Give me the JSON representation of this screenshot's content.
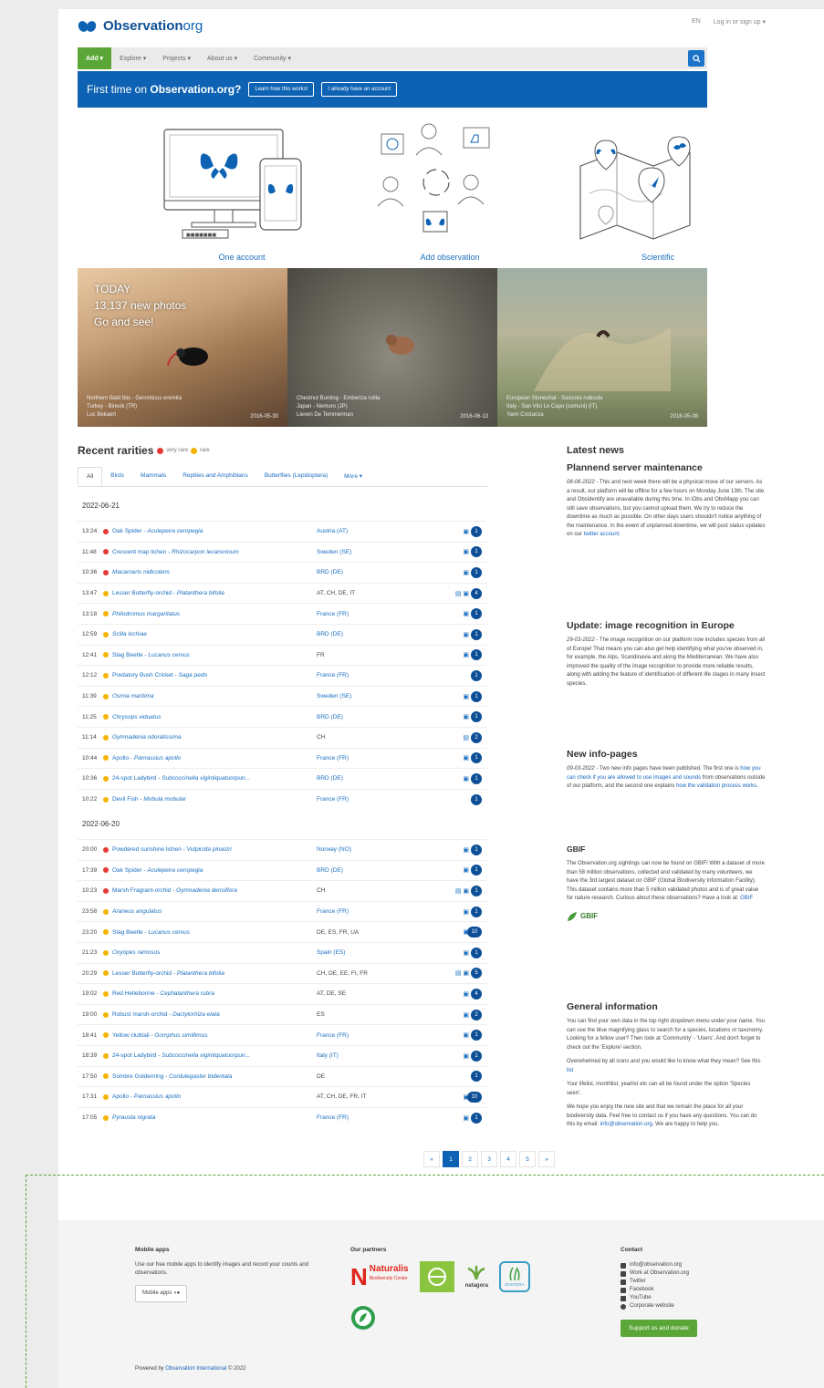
{
  "header": {
    "logo_main": "Observation",
    "logo_suffix": "org",
    "lang": "EN",
    "login": "Log in or sign up ▾"
  },
  "nav": {
    "add": "Add ▾",
    "items": [
      "Explore ▾",
      "Projects ▾",
      "About us ▾",
      "Community ▾"
    ]
  },
  "banner": {
    "text_prefix": "First time on ",
    "text_bold": "Observation.org?",
    "btn_learn": "Learn how this works!",
    "btn_account": "I already have an account"
  },
  "features": [
    "One account",
    "Add observation",
    "Scientific"
  ],
  "photos": {
    "today_line1": "TODAY",
    "today_line2": "13,137 new photos",
    "today_line3": "Go and see!",
    "items": [
      {
        "species": "Northern Bald Ibis - Geronticus eremita",
        "place": "Turkey - Birecik (TR)",
        "user": "Luc Bekaert",
        "date": "2016-05-30"
      },
      {
        "species": "Chestnut Bunting - Emberiza rutila",
        "place": "Japan - Nemuro (JP)",
        "user": "Lieven De Temmerman",
        "date": "2016-06-13"
      },
      {
        "species": "European Stonechat - Saxicola rubicola",
        "place": "Italy - San Vito Lo Capo (comuni) (IT)",
        "user": "Yann Costanza",
        "date": "2016-05-08"
      }
    ]
  },
  "rarities": {
    "title": "Recent rarities",
    "legend_very_rare": "very rare",
    "legend_rare": "rare",
    "tabs": [
      "All",
      "Birds",
      "Mammals",
      "Reptiles and Amphibians",
      "Butterflies (Lepidoptera)",
      "More ▾"
    ],
    "day1": "2022-06-21",
    "day2": "2022-06-20",
    "rows1": [
      {
        "time": "13:24",
        "rarity": "very-rare",
        "common": "Oak Spider - ",
        "sci": "Aculepeira ceropegia",
        "loc": "Austria (AT)",
        "link": true,
        "icons": "▣",
        "count": "1"
      },
      {
        "time": "11:48",
        "rarity": "very-rare",
        "common": "Crescent map lichen - ",
        "sci": "Rhizocarpon lecanorinum",
        "loc": "Sweden (SE)",
        "link": true,
        "icons": "▣",
        "count": "1"
      },
      {
        "time": "10:36",
        "rarity": "very-rare",
        "common": "",
        "sci": "Macaroeris nidicolens",
        "loc": "BRD (DE)",
        "link": true,
        "icons": "▣",
        "count": "1"
      },
      {
        "time": "13:47",
        "rarity": "rare",
        "common": "Lesser Butterfly-orchid - ",
        "sci": "Platanthera bifolia",
        "loc": "AT, CH, DE, IT",
        "link": false,
        "icons": "▤ ▣",
        "count": "4"
      },
      {
        "time": "13:18",
        "rarity": "rare",
        "common": "",
        "sci": "Philodromus margaritatus",
        "loc": "France (FR)",
        "link": true,
        "icons": "▣",
        "count": "1"
      },
      {
        "time": "12:59",
        "rarity": "rare",
        "common": "",
        "sci": "Scilla lochiae",
        "loc": "BRD (DE)",
        "link": true,
        "icons": "▣",
        "count": "1"
      },
      {
        "time": "12:41",
        "rarity": "rare",
        "common": "Stag Beetle - ",
        "sci": "Lucanus cervus",
        "loc": "FR",
        "link": false,
        "icons": "▣",
        "count": "1"
      },
      {
        "time": "12:12",
        "rarity": "rare",
        "common": "Predatory Bush Cricket - ",
        "sci": "Saga pedo",
        "loc": "France (FR)",
        "link": true,
        "icons": "",
        "count": "1"
      },
      {
        "time": "11:39",
        "rarity": "rare",
        "common": "",
        "sci": "Osmia maritima",
        "loc": "Sweden (SE)",
        "link": true,
        "icons": "▣",
        "count": "1"
      },
      {
        "time": "11:25",
        "rarity": "rare",
        "common": "",
        "sci": "Chrysops viduatus",
        "loc": "BRD (DE)",
        "link": true,
        "icons": "▣",
        "count": "1"
      },
      {
        "time": "11:14",
        "rarity": "rare",
        "common": "",
        "sci": "Gymnadenia odoratissima",
        "loc": "CH",
        "link": false,
        "icons": "▤",
        "count": "2"
      },
      {
        "time": "10:44",
        "rarity": "rare",
        "common": "Apollo - ",
        "sci": "Parnassius apollo",
        "loc": "France (FR)",
        "link": true,
        "icons": "▣",
        "count": "1"
      },
      {
        "time": "10:36",
        "rarity": "rare",
        "common": "24-spot Ladybird - ",
        "sci": "Subcoccinella vigintiquatuorpun...",
        "loc": "BRD (DE)",
        "link": true,
        "icons": "▣",
        "count": "1"
      },
      {
        "time": "10:22",
        "rarity": "rare",
        "common": "Devil Fish - ",
        "sci": "Mobula mobular",
        "loc": "France (FR)",
        "link": true,
        "icons": "",
        "count": "1"
      }
    ],
    "rows2": [
      {
        "time": "20:00",
        "rarity": "very-rare",
        "common": "Powdered sunshine lichen - ",
        "sci": "Vulpicida pinastri",
        "loc": "Norway (NO)",
        "link": true,
        "icons": "▣",
        "count": "1"
      },
      {
        "time": "17:39",
        "rarity": "very-rare",
        "common": "Oak Spider - ",
        "sci": "Aculepeira ceropegia",
        "loc": "BRD (DE)",
        "link": true,
        "icons": "▣",
        "count": "1"
      },
      {
        "time": "10:23",
        "rarity": "very-rare",
        "common": "Marsh Fragrant-orchid - ",
        "sci": "Gymnadenia densiflora",
        "loc": "CH",
        "link": false,
        "icons": "▤ ▣",
        "count": "1"
      },
      {
        "time": "23:58",
        "rarity": "rare",
        "common": "",
        "sci": "Araneus angulatus",
        "loc": "France (FR)",
        "link": true,
        "icons": "▣",
        "count": "1"
      },
      {
        "time": "23:20",
        "rarity": "rare",
        "common": "Stag Beetle - ",
        "sci": "Lucanus cervus",
        "loc": "DE, ES, FR, UA",
        "link": false,
        "icons": "▣",
        "count": "10"
      },
      {
        "time": "21:23",
        "rarity": "rare",
        "common": "",
        "sci": "Oxyopes ramosus",
        "loc": "Spain (ES)",
        "link": true,
        "icons": "▣",
        "count": "1"
      },
      {
        "time": "20:29",
        "rarity": "rare",
        "common": "Lesser Butterfly-orchid - ",
        "sci": "Platanthera bifolia",
        "loc": "CH, DE, EE, FI, FR",
        "link": false,
        "icons": "▤ ▣",
        "count": "5"
      },
      {
        "time": "19:02",
        "rarity": "rare",
        "common": "Red Helleborine - ",
        "sci": "Cephalanthera rubra",
        "loc": "AT, DE, SE",
        "link": false,
        "icons": "▣",
        "count": "4"
      },
      {
        "time": "19:00",
        "rarity": "rare",
        "common": "Robust marsh-orchid - ",
        "sci": "Dactylorhiza elata",
        "loc": "ES",
        "link": false,
        "icons": "▣",
        "count": "2"
      },
      {
        "time": "18:41",
        "rarity": "rare",
        "common": "Yellow clubtail - ",
        "sci": "Gomphus simillimus",
        "loc": "France (FR)",
        "link": true,
        "icons": "▣",
        "count": "1"
      },
      {
        "time": "18:39",
        "rarity": "rare",
        "common": "24-spot Ladybird - ",
        "sci": "Subcoccinella vigintiquatuorpun...",
        "loc": "Italy (IT)",
        "link": true,
        "icons": "▣",
        "count": "1"
      },
      {
        "time": "17:50",
        "rarity": "rare",
        "common": "Sombre Goldenring - ",
        "sci": "Cordulegaster bidentata",
        "loc": "DE",
        "link": false,
        "icons": "",
        "count": "1"
      },
      {
        "time": "17:31",
        "rarity": "rare",
        "common": "Apollo - ",
        "sci": "Parnassius apollo",
        "loc": "AT, CH, DE, FR, IT",
        "link": false,
        "icons": "▣",
        "count": "10"
      },
      {
        "time": "17:05",
        "rarity": "rare",
        "common": "",
        "sci": "Pyrausta nigrata",
        "loc": "France (FR)",
        "link": true,
        "icons": "▣",
        "count": "1"
      }
    ],
    "pager": [
      "«",
      "1",
      "2",
      "3",
      "4",
      "5",
      "»"
    ]
  },
  "news": {
    "title": "Latest news",
    "n1_title": "Plannend server maintenance",
    "n1_date": "08-06-2022",
    "n1_body": " - This and next week there will be a physical move of our servers. As a result, our platform will be offline for a few hours on Monday June 13th. The site and Obsidentify are unavailable during this time. In iObs and ObsMapp you can still save observations, but you cannot upload them. We try to reduce the downtime as much as possible. On other days users shouldn't notice anything of the maintenance. In the event of unplanned downtime, we will post status updates on our ",
    "n1_link": "twitter account",
    "n2_title": "Update: image recognition in Europe",
    "n2_date": "29-03-2022",
    "n2_body": " - The image recognition on our platform now includes species from all of Europe! That means you can also get help identifying what you've observed in, for example, the Alps, Scandinavia and along the Mediterranean. We have also improved the quality of the image recognition to provide more reliable results, along with adding the feature of identification of different life stages in many insect species.",
    "n3_title": "New info-pages",
    "n3_date": "09-03-2022",
    "n3_body_a": " - Two new info pages have been published. The first one is ",
    "n3_link_a": "how you can check if you are allowed to use images and sounds",
    "n3_body_b": " from observations outside of our platform, and the second one explains ",
    "n3_link_b": "how the validation process works",
    "gbif_title": "GBIF",
    "gbif_body": "The Observation.org sightings can now be found on GBIF! With a dataset of more than 58 million observations, collected and validated by many volunteers, we have the 3rd largest dataset on GBIF (Global Biodiversity Information Facility). This dataset contains more than 5 million validated photos and is of great value for nature research. Curious about these observations? Have a look at: ",
    "gbif_link": "GBIF",
    "gbif_logo": "GBIF",
    "gi_title": "General information",
    "gi_p1": "You can find your own data in the top right dropdown menu under your name. You can use the blue magnifying glass to search for a species, locations or taxonomy. Looking for a fellow user? Then look at 'Community' - 'Users'. And don't forget to check out the 'Explore'-section.",
    "gi_p2a": "Overwhelmed by all icons and you would like to know what they mean? See this ",
    "gi_p2_link": "list",
    "gi_p3": "Your lifelist, monthlist, yearlist etc can all be found under the option 'Species seen'.",
    "gi_p4a": "We hope you enjoy the new site and that we remain the place for all your biodiversity data. Feel free to contact us if you have any questions. You can do this by email: ",
    "gi_p4_link": "info@observation.org",
    "gi_p4b": ". We are happy to help you."
  },
  "footer": {
    "apps_title": "Mobile apps",
    "apps_text": "Use our free mobile apps to identify images and record your counts and observations.",
    "apps_btn": "Mobile apps",
    "partners_title": "Our partners",
    "partner_naturalis": "Naturalis",
    "partner_naturalis_sub": "Biodiversity Center",
    "partner_natagora": "natagora",
    "partner_zostera": "ZOSTERA",
    "contact_title": "Contact",
    "contact_items": [
      "info@observation.org",
      "Work at Observation.org",
      "Twitter",
      "Facebook",
      "YouTube",
      "Corporate website"
    ],
    "donate": "Support us and donate",
    "powered_prefix": "Powered by ",
    "powered_link": "Observation International",
    "powered_suffix": " © 2022"
  },
  "colors": {
    "brand_blue": "#0d62b3",
    "add_green": "#5aa637",
    "very_rare": "#e53935",
    "rare": "#f4b400"
  }
}
